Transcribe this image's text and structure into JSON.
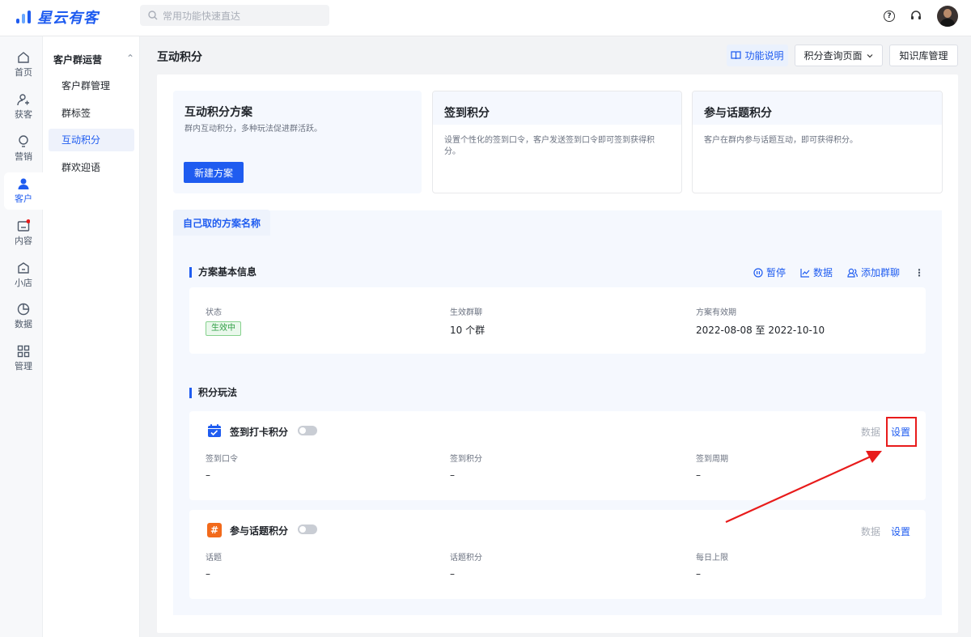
{
  "brand": {
    "name": "星云有客"
  },
  "search": {
    "placeholder": "常用功能快速直达"
  },
  "topbar": {
    "help_icon": "?",
    "headset_icon": "headset"
  },
  "leftnav": [
    {
      "label": "首页",
      "icon": "home-icon"
    },
    {
      "label": "获客",
      "icon": "user-add-icon"
    },
    {
      "label": "营销",
      "icon": "bulb-icon"
    },
    {
      "label": "客户",
      "icon": "user-icon"
    },
    {
      "label": "内容",
      "icon": "folder-icon"
    },
    {
      "label": "小店",
      "icon": "shop-icon"
    },
    {
      "label": "数据",
      "icon": "pie-icon"
    },
    {
      "label": "管理",
      "icon": "grid-icon"
    }
  ],
  "subnav": {
    "group": "客户群运营",
    "items": [
      "客户群管理",
      "群标签",
      "互动积分",
      "群欢迎语"
    ]
  },
  "header": {
    "title": "互动积分",
    "help": "功能说明",
    "dropdown": "积分查询页面",
    "kb": "知识库管理"
  },
  "cards": [
    {
      "title": "互动积分方案",
      "desc": "群内互动积分，多种玩法促进群活跃。",
      "button": "新建方案"
    },
    {
      "title": "签到积分",
      "desc": "设置个性化的签到口令，客户发送签到口令即可签到获得积分。"
    },
    {
      "title": "参与话题积分",
      "desc": "客户在群内参与话题互动，即可获得积分。"
    }
  ],
  "tab": {
    "label": "自己取的方案名称"
  },
  "basic": {
    "title": "方案基本信息",
    "actions": {
      "pause": "暂停",
      "data": "数据",
      "add_group": "添加群聊",
      "more": "⋮"
    },
    "status_label": "状态",
    "status_value": "生效中",
    "groups_label": "生效群聊",
    "groups_value": "10 个群",
    "period_label": "方案有效期",
    "period_value": "2022-08-08 至 2022-10-10"
  },
  "plays": {
    "title": "积分玩法",
    "checkin": {
      "title": "签到打卡积分",
      "data": "数据",
      "setting": "设置",
      "f1": "签到口令",
      "v1": "–",
      "f2": "签到积分",
      "v2": "–",
      "f3": "签到周期",
      "v3": "–"
    },
    "topic": {
      "title": "参与话题积分",
      "icon": "#",
      "data": "数据",
      "setting": "设置",
      "f1": "话题",
      "v1": "–",
      "f2": "话题积分",
      "v2": "–",
      "f3": "每日上限",
      "v3": "–"
    }
  },
  "colors": {
    "accent": "#1f5cf0",
    "highlight": "#e81b1b",
    "success": "#2f9e44"
  }
}
